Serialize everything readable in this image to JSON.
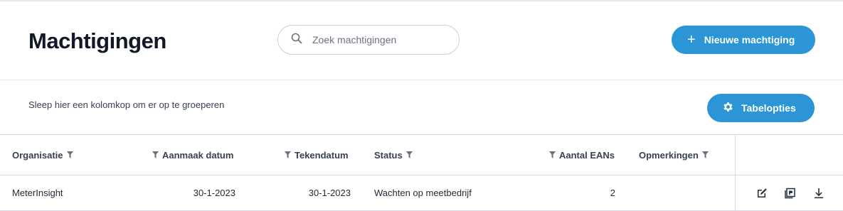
{
  "header": {
    "title": "Machtigingen",
    "search_placeholder": "Zoek machtigingen",
    "new_button": {
      "icon": "plus-icon",
      "label": "Nieuwe machtiging"
    }
  },
  "toolbar": {
    "group_hint": "Sleep hier een kolomkop om er op te groeperen",
    "options_button": {
      "icon": "gear-icon",
      "label": "Tabelopties"
    }
  },
  "table": {
    "columns": [
      {
        "label": "Organisatie"
      },
      {
        "label": "Aanmaak datum"
      },
      {
        "label": "Tekendatum"
      },
      {
        "label": "Status"
      },
      {
        "label": "Aantal EANs"
      },
      {
        "label": "Opmerkingen"
      }
    ],
    "rows": [
      {
        "organisatie": "MeterInsight",
        "aanmaak_datum": "30-1-2023",
        "tekendatum": "30-1-2023",
        "status": "Wachten op meetbedrijf",
        "aantal_eans": "2",
        "opmerkingen": "",
        "actions": [
          "edit-icon",
          "pdf-icon",
          "download-icon"
        ]
      }
    ]
  },
  "colors": {
    "accent": "#2b95d6",
    "title": "#111827",
    "border": "#d7dbe0"
  }
}
